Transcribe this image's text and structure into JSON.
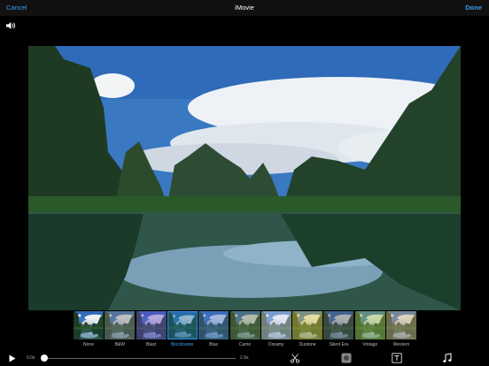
{
  "header": {
    "cancel_label": "Cancel",
    "title": "iMovie",
    "done_label": "Done"
  },
  "audio": {
    "icon": "speaker-icon"
  },
  "filters": {
    "items": [
      {
        "label": "None",
        "tint": "none"
      },
      {
        "label": "B&W",
        "tint": "#808080"
      },
      {
        "label": "Blast",
        "tint": "#6a4cc4"
      },
      {
        "label": "Blockbuster",
        "tint": "#1c6f9a"
      },
      {
        "label": "Blue",
        "tint": "#4a73c2"
      },
      {
        "label": "Camo",
        "tint": "#6b7a4a"
      },
      {
        "label": "Dreamy",
        "tint": "#d8d8e8"
      },
      {
        "label": "Duotone",
        "tint": "#d9c23a"
      },
      {
        "label": "Silent Era",
        "tint": "#5a5a5a"
      },
      {
        "label": "Vintage",
        "tint": "#9bb84a"
      },
      {
        "label": "Western",
        "tint": "#c8a878"
      }
    ],
    "selected_label": "Blockbuster"
  },
  "playback": {
    "current_time": "0.0s",
    "end_time": "2.9s",
    "progress": 0
  },
  "toolbar": {
    "tools": [
      "scissors-icon",
      "filter-icon",
      "title-icon",
      "music-icon"
    ]
  },
  "colors": {
    "accent": "#3a9bf0"
  }
}
